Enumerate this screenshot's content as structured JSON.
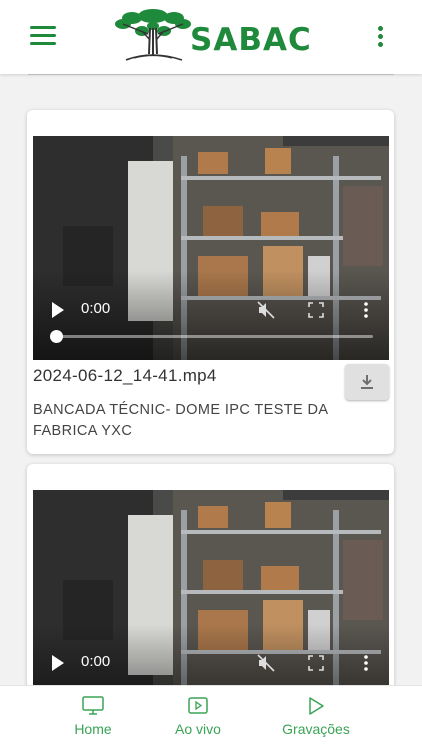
{
  "header": {
    "brand": "SABAC",
    "menu_icon": "hamburger-menu-icon",
    "more_icon": "kebab-menu-icon",
    "accent": "#1f8a3b"
  },
  "recordings": [
    {
      "time": "0:00",
      "filename": "2024-06-12_14-41.mp4",
      "description": "BANCADA TÉCNIC- DOME IPC TESTE DA FABRICA YXC",
      "progress": 0
    },
    {
      "time": "0:00",
      "progress": 0
    }
  ],
  "bottom_nav": {
    "items": [
      {
        "label": "Home",
        "icon": "monitor-icon"
      },
      {
        "label": "Ao vivo",
        "icon": "play-square-icon"
      },
      {
        "label": "Gravações",
        "icon": "play-triangle-icon"
      }
    ],
    "color": "#3aa356"
  }
}
